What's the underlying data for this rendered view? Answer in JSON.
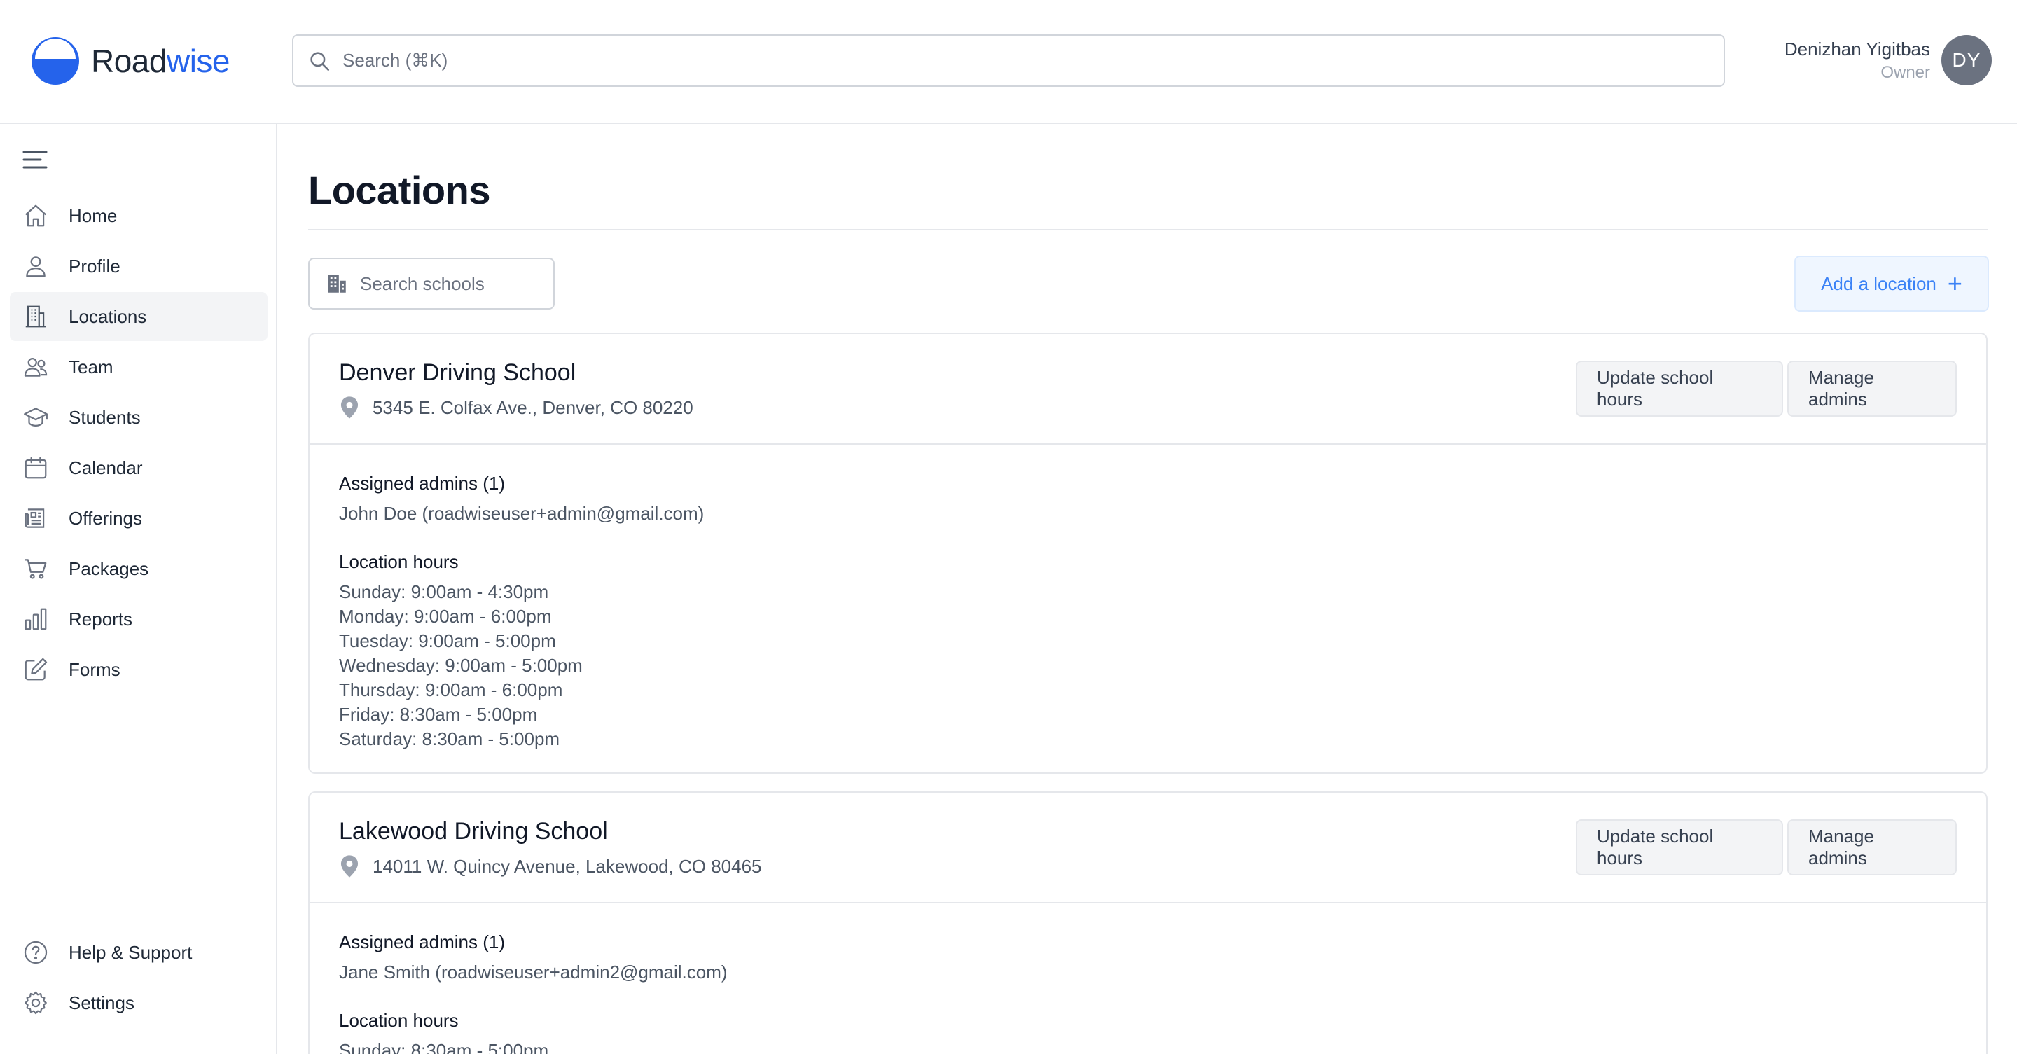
{
  "app": {
    "brand_part1": "Road",
    "brand_part2": "wise",
    "search_placeholder": "Search (⌘K)",
    "colors": {
      "brand": "#2563eb",
      "accent_bg": "#eff6ff",
      "accent_text": "#3b82f6"
    }
  },
  "user": {
    "name": "Denizhan Yigitbas",
    "role": "Owner",
    "initials": "DY"
  },
  "sidebar": {
    "items": [
      {
        "label": "Home",
        "icon": "home-icon"
      },
      {
        "label": "Profile",
        "icon": "user-icon"
      },
      {
        "label": "Locations",
        "icon": "building-icon",
        "active": true
      },
      {
        "label": "Team",
        "icon": "users-icon"
      },
      {
        "label": "Students",
        "icon": "graduation-cap-icon"
      },
      {
        "label": "Calendar",
        "icon": "calendar-icon"
      },
      {
        "label": "Offerings",
        "icon": "newspaper-icon"
      },
      {
        "label": "Packages",
        "icon": "cart-icon"
      },
      {
        "label": "Reports",
        "icon": "bar-chart-icon"
      },
      {
        "label": "Forms",
        "icon": "edit-icon"
      }
    ],
    "bottom": [
      {
        "label": "Help & Support",
        "icon": "help-icon"
      },
      {
        "label": "Settings",
        "icon": "gear-icon"
      }
    ]
  },
  "page": {
    "title": "Locations",
    "school_search_placeholder": "Search schools",
    "add_label": "Add a location"
  },
  "labels": {
    "update_hours": "Update school hours",
    "manage_admins": "Manage admins"
  },
  "locations": [
    {
      "name": "Denver Driving School",
      "address": "5345 E. Colfax Ave., Denver, CO 80220",
      "admins_title": "Assigned admins (1)",
      "admins": [
        "John Doe (roadwiseuser+admin@gmail.com)"
      ],
      "hours_title": "Location hours",
      "hours": [
        "Sunday: 9:00am - 4:30pm",
        "Monday: 9:00am - 6:00pm",
        "Tuesday: 9:00am - 5:00pm",
        "Wednesday: 9:00am - 5:00pm",
        "Thursday: 9:00am - 6:00pm",
        "Friday: 8:30am - 5:00pm",
        "Saturday: 8:30am - 5:00pm"
      ]
    },
    {
      "name": "Lakewood Driving School",
      "address": "14011 W. Quincy Avenue, Lakewood, CO 80465",
      "admins_title": "Assigned admins (1)",
      "admins": [
        "Jane Smith (roadwiseuser+admin2@gmail.com)"
      ],
      "hours_title": "Location hours",
      "hours": [
        "Sunday: 8:30am - 5:00pm"
      ]
    }
  ]
}
